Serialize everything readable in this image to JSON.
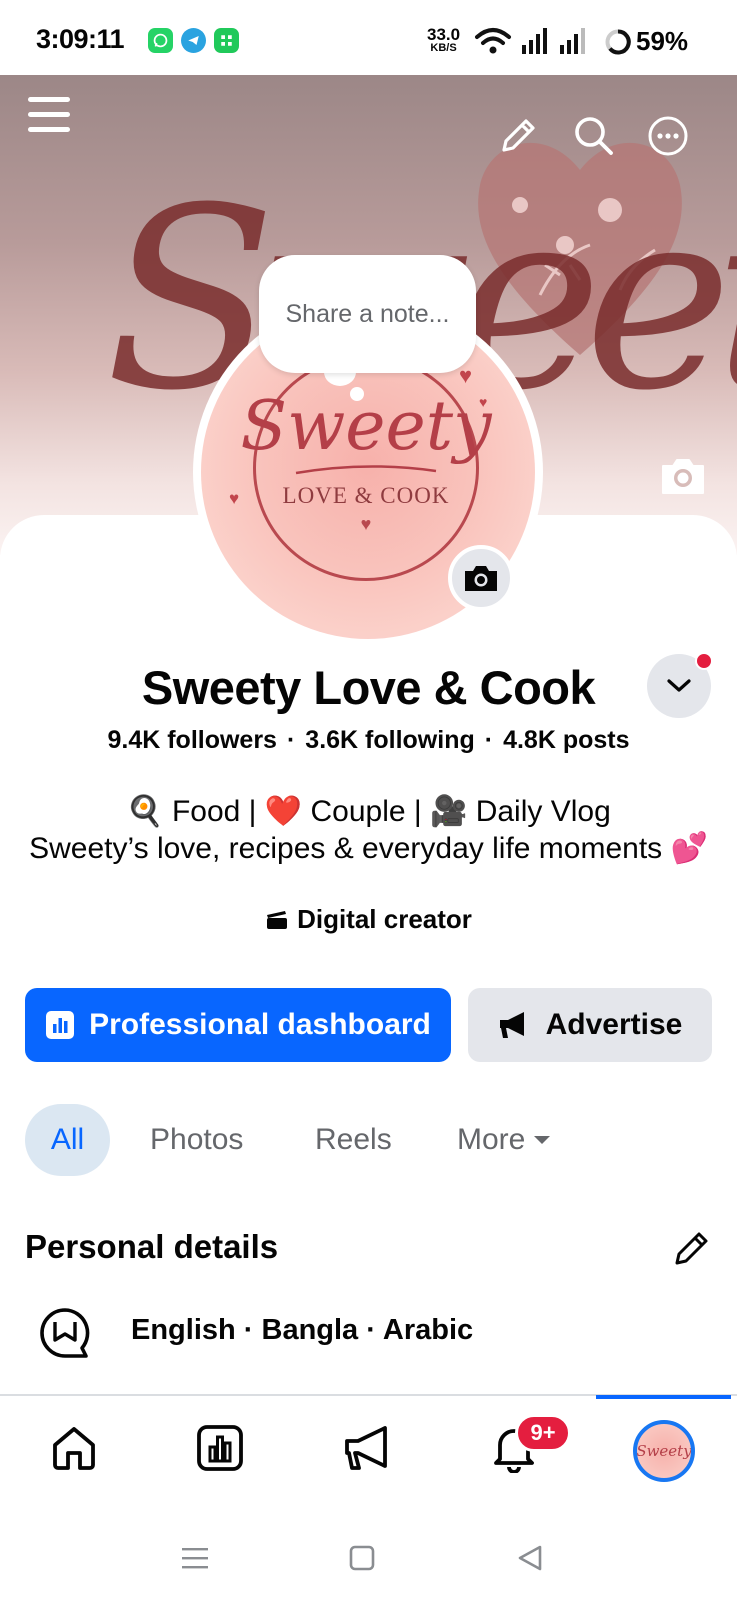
{
  "status_bar": {
    "time": "3:09:11",
    "net_speed_value": "33.0",
    "net_speed_unit": "KB/S",
    "battery": "59%",
    "app_icons": [
      "whatsapp-icon",
      "telegram-icon",
      "green-app-icon"
    ]
  },
  "cover": {
    "script_text": "Sweety"
  },
  "note": {
    "placeholder": "Share a note..."
  },
  "avatar": {
    "script": "Sweety",
    "subtitle": "LOVE & COOK"
  },
  "profile": {
    "name": "Sweety Love & Cook",
    "followers": "9.4K followers",
    "following": "3.6K following",
    "posts": "4.8K posts",
    "separator": "·",
    "bio_line1": "🍳 Food | ❤️ Couple | 🎥 Daily Vlog",
    "bio_line2": "Sweety’s love, recipes & everyday life moments 💕",
    "category": "Digital creator"
  },
  "actions": {
    "dashboard_label": "Professional dashboard",
    "advertise_label": "Advertise"
  },
  "tabs": [
    {
      "label": "All",
      "selected": true
    },
    {
      "label": "Photos",
      "selected": false
    },
    {
      "label": "Reels",
      "selected": false
    },
    {
      "label": "More",
      "selected": false
    }
  ],
  "personal_details": {
    "title": "Personal details",
    "languages": "English · Bangla · Arabic"
  },
  "bottom_nav": {
    "items": [
      "home-icon",
      "dashboard-icon",
      "megaphone-icon",
      "bell-icon",
      "profile-avatar"
    ],
    "notification_badge": "9+",
    "avatar_text": "Sweety"
  },
  "colors": {
    "accent_blue": "#0866ff",
    "badge_red": "#e41e3f",
    "button_gray": "#e4e6eb",
    "tab_selected_bg": "#dbe7f2",
    "muted_text": "#65676b"
  }
}
